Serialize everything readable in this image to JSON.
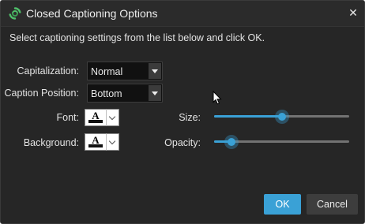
{
  "window": {
    "title": "Closed Captioning Options",
    "close_glyph": "✕",
    "app_icon": "refresh-arrows-icon"
  },
  "instructions": "Select captioning settings from the list below and click OK.",
  "fields": {
    "capitalization": {
      "label": "Capitalization:",
      "value": "Normal"
    },
    "caption_position": {
      "label": "Caption Position:",
      "value": "Bottom"
    },
    "font": {
      "label": "Font:",
      "letter": "A",
      "color": "#000000",
      "bar_color": "#111111"
    },
    "background": {
      "label": "Background:",
      "letter": "A",
      "color": "#000000",
      "bar_color": "#111111"
    },
    "size": {
      "label": "Size:",
      "level_fraction": 0.5
    },
    "opacity": {
      "label": "Opacity:",
      "level_fraction": 0.13
    }
  },
  "buttons": {
    "ok": "OK",
    "cancel": "Cancel"
  },
  "colors": {
    "accent": "#3aa1d6",
    "dialog_bg": "#262626",
    "icon_green": "#4fbf6a"
  }
}
